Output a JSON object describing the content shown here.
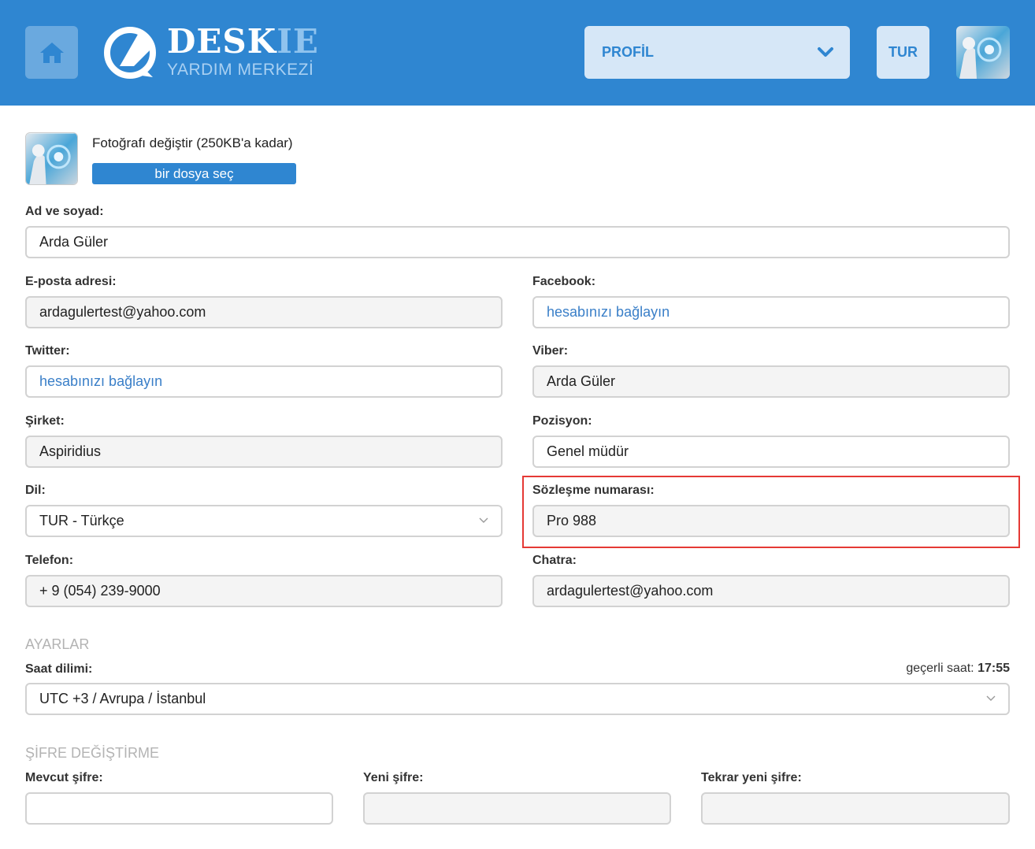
{
  "header": {
    "logo_main": "DESK",
    "logo_accent": "IE",
    "logo_sub": "YARDIM MERKEZİ",
    "profile_menu": "PROFİL",
    "language": "TUR"
  },
  "photo": {
    "label": "Fotoğrafı değiştir (250KB'a kadar)",
    "button": "bir dosya seç"
  },
  "form": {
    "name": {
      "label": "Ad ve soyad:",
      "value": "Arda Güler"
    },
    "email": {
      "label": "E-posta adresi:",
      "value": "ardagulertest@yahoo.com"
    },
    "facebook": {
      "label": "Facebook:",
      "value": "hesabınızı bağlayın"
    },
    "twitter": {
      "label": "Twitter:",
      "value": "hesabınızı bağlayın"
    },
    "viber": {
      "label": "Viber:",
      "value": "Arda Güler"
    },
    "company": {
      "label": "Şirket:",
      "value": "Aspiridius"
    },
    "position": {
      "label": "Pozisyon:",
      "value": "Genel müdür"
    },
    "language": {
      "label": "Dil:",
      "value": "TUR - Türkçe"
    },
    "contract": {
      "label": "Sözleşme numarası:",
      "value": "Pro 988"
    },
    "phone": {
      "label": "Telefon:",
      "value": "+ 9 (054) 239-9000"
    },
    "chatra": {
      "label": "Chatra:",
      "value": "ardagulertest@yahoo.com"
    }
  },
  "settings": {
    "section_title": "AYARLAR",
    "timezone_label": "Saat dilimi:",
    "current_time_label": "geçerli saat:",
    "current_time_value": "17:55",
    "timezone_value": "UTC +3 / Avrupa / İstanbul"
  },
  "password": {
    "section_title": "ŞİFRE DEĞİŞTİRME",
    "current_label": "Mevcut şifre:",
    "new_label": "Yeni şifre:",
    "repeat_label": "Tekrar yeni şifre:",
    "current_value": "",
    "new_value": "",
    "repeat_value": ""
  },
  "colors": {
    "header_bg": "#2f86d1",
    "accent": "#2f86d1",
    "highlight": "#e53935",
    "link": "#3a7fc8"
  }
}
